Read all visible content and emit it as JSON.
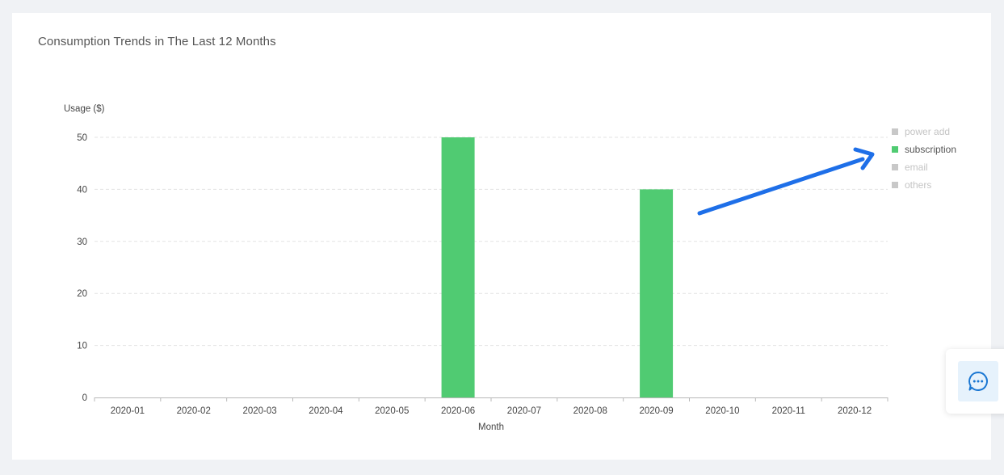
{
  "card": {
    "title": "Consumption Trends in The Last 12 Months"
  },
  "chart_data": {
    "type": "bar",
    "title": "Consumption Trends in The Last 12 Months",
    "xlabel": "Month",
    "ylabel": "Usage ($)",
    "ylim": [
      0,
      50
    ],
    "yticks": [
      0,
      10,
      20,
      30,
      40,
      50
    ],
    "grid": true,
    "legend_position": "right",
    "categories": [
      "2020-01",
      "2020-02",
      "2020-03",
      "2020-04",
      "2020-05",
      "2020-06",
      "2020-07",
      "2020-08",
      "2020-09",
      "2020-10",
      "2020-11",
      "2020-12"
    ],
    "series": [
      {
        "name": "power add",
        "color": "#c8c8c8",
        "active": false,
        "values": [
          0,
          0,
          0,
          0,
          0,
          0,
          0,
          0,
          0,
          0,
          0,
          0
        ]
      },
      {
        "name": "subscription",
        "color": "#50cb72",
        "active": true,
        "values": [
          0,
          0,
          0,
          0,
          0,
          50,
          0,
          0,
          40,
          0,
          0,
          0
        ]
      },
      {
        "name": "email",
        "color": "#c8c8c8",
        "active": false,
        "values": [
          0,
          0,
          0,
          0,
          0,
          0,
          0,
          0,
          0,
          0,
          0,
          0
        ]
      },
      {
        "name": "others",
        "color": "#c8c8c8",
        "active": false,
        "values": [
          0,
          0,
          0,
          0,
          0,
          0,
          0,
          0,
          0,
          0,
          0,
          0
        ]
      }
    ]
  },
  "annotation": {
    "arrow_color": "#1e6fe8"
  },
  "chat_widget": {
    "icon": "chat-bubble-icon",
    "background": "#e6f2fc",
    "icon_color": "#1976d2"
  }
}
